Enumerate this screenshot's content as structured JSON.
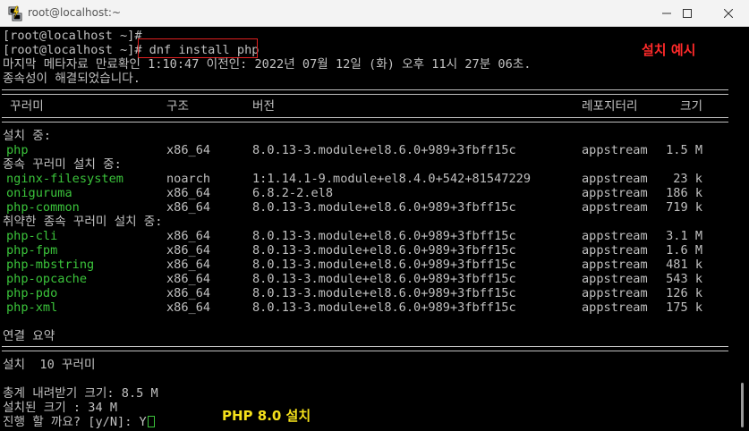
{
  "window": {
    "title": "root@localhost:~",
    "icon": "putty-terminal-icon"
  },
  "terminal": {
    "prompt_line_1": "[root@localhost ~]#",
    "prompt_line_2": "[root@localhost ~]#",
    "command": " dnf install php",
    "metadata_line": "마지막 메타자료 만료확인 1:10:47 이전인: 2022년 07월 12일 (화) 오후 11시 27분 06초.",
    "deps_resolved": "종속성이 해결되었습니다.",
    "headers": {
      "name": " 꾸러미",
      "arch": "구조",
      "version": "버전",
      "repo": "레포지터리",
      "size": "크기"
    },
    "section_installing": "설치 중:",
    "section_dependencies": "종속 꾸러미 설치 중:",
    "section_weak": "취약한 종속 꾸러미 설치 중:",
    "packages_main": [
      {
        "name": "php",
        "arch": "x86_64",
        "version": "8.0.13-3.module+el8.6.0+989+3fbff15c",
        "repo": "appstream",
        "size": "1.5 M"
      }
    ],
    "packages_deps": [
      {
        "name": "nginx-filesystem",
        "arch": "noarch",
        "version": "1:1.14.1-9.module+el8.4.0+542+81547229",
        "repo": "appstream",
        "size": "23 k"
      },
      {
        "name": "oniguruma",
        "arch": "x86_64",
        "version": "6.8.2-2.el8",
        "repo": "appstream",
        "size": "186 k"
      },
      {
        "name": "php-common",
        "arch": "x86_64",
        "version": "8.0.13-3.module+el8.6.0+989+3fbff15c",
        "repo": "appstream",
        "size": "719 k"
      }
    ],
    "packages_weak": [
      {
        "name": "php-cli",
        "arch": "x86_64",
        "version": "8.0.13-3.module+el8.6.0+989+3fbff15c",
        "repo": "appstream",
        "size": "3.1 M"
      },
      {
        "name": "php-fpm",
        "arch": "x86_64",
        "version": "8.0.13-3.module+el8.6.0+989+3fbff15c",
        "repo": "appstream",
        "size": "1.6 M"
      },
      {
        "name": "php-mbstring",
        "arch": "x86_64",
        "version": "8.0.13-3.module+el8.6.0+989+3fbff15c",
        "repo": "appstream",
        "size": "481 k"
      },
      {
        "name": "php-opcache",
        "arch": "x86_64",
        "version": "8.0.13-3.module+el8.6.0+989+3fbff15c",
        "repo": "appstream",
        "size": "543 k"
      },
      {
        "name": "php-pdo",
        "arch": "x86_64",
        "version": "8.0.13-3.module+el8.6.0+989+3fbff15c",
        "repo": "appstream",
        "size": "126 k"
      },
      {
        "name": "php-xml",
        "arch": "x86_64",
        "version": "8.0.13-3.module+el8.6.0+989+3fbff15c",
        "repo": "appstream",
        "size": "175 k"
      }
    ],
    "summary_title": "연결 요약",
    "summary_install": "설치  10 꾸러미",
    "download_size": "총계 내려받기 크기: 8.5 M",
    "installed_size": "설치된 크기 : 34 M",
    "confirm_prompt": "진행 할 까요? [y/N]: Y"
  },
  "annotations": {
    "example_label": "설치 예시",
    "php_label": "PHP 8.0 설치"
  },
  "colors": {
    "terminal_bg": "#000000",
    "terminal_fg": "#c0c0c0",
    "package_green": "#3bc43b",
    "highlight_red": "#e02020",
    "annotation_yellow": "#f5e11b"
  }
}
